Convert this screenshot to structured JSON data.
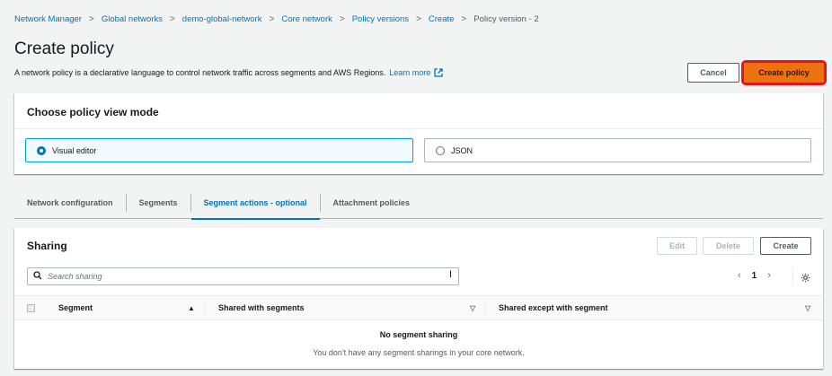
{
  "breadcrumbs": [
    {
      "label": "Network Manager"
    },
    {
      "label": "Global networks"
    },
    {
      "label": "demo-global-network"
    },
    {
      "label": "Core network"
    },
    {
      "label": "Policy versions"
    },
    {
      "label": "Create"
    },
    {
      "label": "Policy version - 2"
    }
  ],
  "header": {
    "title": "Create policy",
    "description": "A network policy is a declarative language to control network traffic across segments and AWS Regions.",
    "learn_more": "Learn more",
    "cancel_label": "Cancel",
    "create_label": "Create policy"
  },
  "view_mode": {
    "title": "Choose policy view mode",
    "options": [
      {
        "label": "Visual editor",
        "selected": true
      },
      {
        "label": "JSON",
        "selected": false
      }
    ]
  },
  "tabs": [
    {
      "label": "Network configuration"
    },
    {
      "label": "Segments"
    },
    {
      "label": "Segment actions - optional",
      "active": true
    },
    {
      "label": "Attachment policies"
    }
  ],
  "sharing": {
    "title": "Sharing",
    "edit_label": "Edit",
    "delete_label": "Delete",
    "create_label": "Create",
    "search_placeholder": "Search sharing",
    "page": "1",
    "columns": [
      "Segment",
      "Shared with segments",
      "Shared except with segment"
    ],
    "empty_title": "No segment sharing",
    "empty_desc": "You don't have any segment sharings in your core network."
  },
  "colors": {
    "accent": "#0073bb",
    "primary_button": "#ec7211",
    "highlight_box": "#e5141b"
  }
}
